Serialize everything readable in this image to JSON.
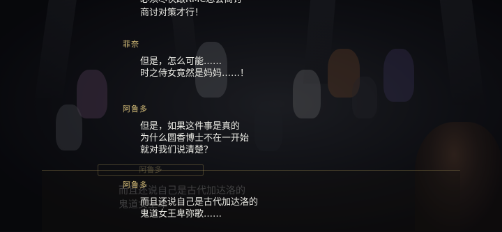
{
  "backlog": {
    "entries": [
      {
        "speaker": "",
        "lines": [
          "必须尽快跟RMC总会商讨",
          "商讨对策才行！"
        ]
      },
      {
        "speaker": "菲奈",
        "lines": [
          "但是，怎么可能……",
          "时之侍女竟然是妈妈……！"
        ]
      },
      {
        "speaker": "阿鲁多",
        "lines": [
          "但是，如果这件事是真的",
          "为什么圆香博士不在一开始",
          "就对我们说清楚？"
        ]
      },
      {
        "speaker": "阿鲁多",
        "lines": [
          "而且还说自己是古代加达洛的",
          "鬼道女王卑弥歌……"
        ]
      }
    ]
  },
  "dialogue_box": {
    "speaker": "阿鲁多",
    "text_line1": "而且还说自己是古代加达洛的",
    "text_line2": "鬼道女王卑"
  }
}
